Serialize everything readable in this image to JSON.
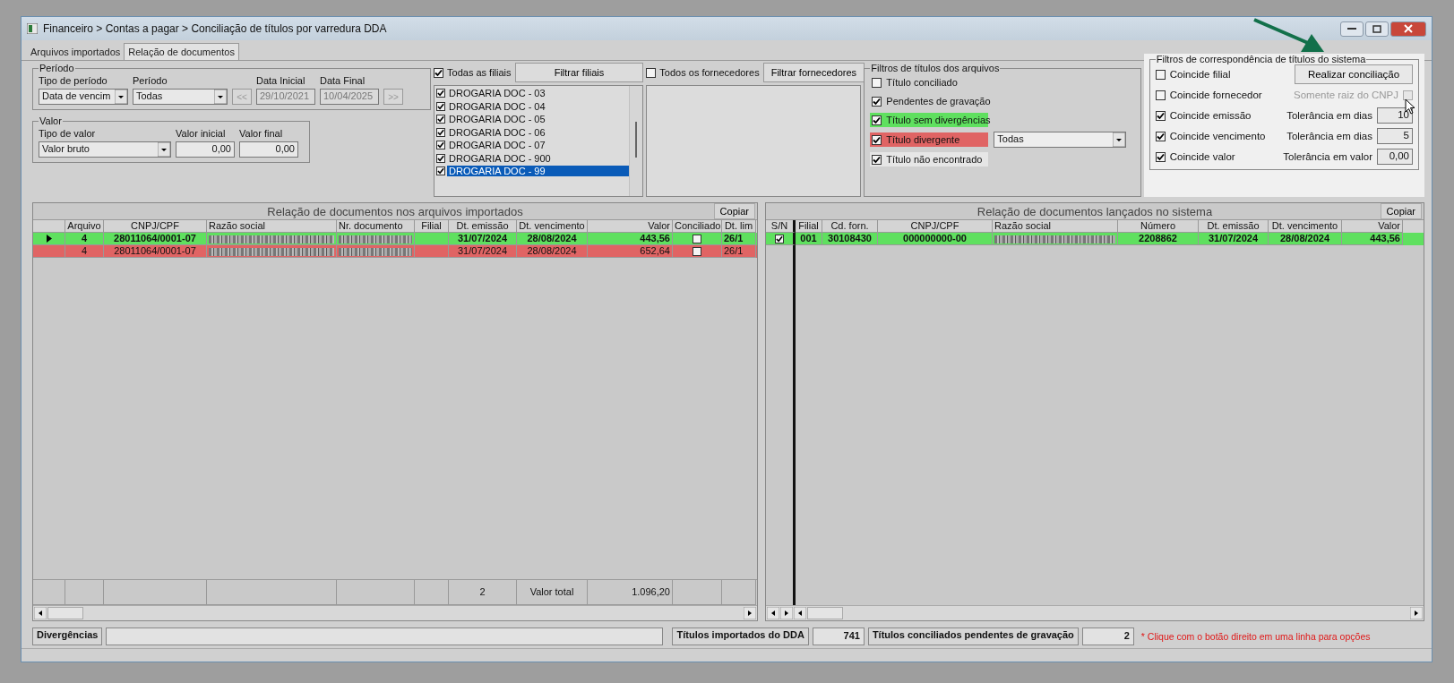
{
  "window": {
    "title": "Financeiro > Contas a pagar > Conciliação de títulos por varredura DDA"
  },
  "tabs": [
    {
      "label": "Arquivos importados",
      "selected": false
    },
    {
      "label": "Relação de documentos",
      "selected": true
    }
  ],
  "periodo": {
    "title": "Período",
    "tipo_label": "Tipo de período",
    "tipo_value": "Data de vencim",
    "periodo_label": "Período",
    "periodo_value": "Todas",
    "prev_button": "<<",
    "data_inicial_label": "Data Inicial",
    "data_inicial": "29/10/2021",
    "data_final_label": "Data Final",
    "data_final": "10/04/2025",
    "next_button": ">>"
  },
  "valor": {
    "title": "Valor",
    "tipo_label": "Tipo de valor",
    "tipo_value": "Valor bruto",
    "inicial_label": "Valor inicial",
    "inicial": "0,00",
    "final_label": "Valor final",
    "final": "0,00"
  },
  "filiais": {
    "all_label": "Todas as filiais",
    "all_checked": true,
    "button": "Filtrar filiais",
    "items": [
      {
        "label": "DROGARIA DOC - 03",
        "checked": true,
        "selected": false
      },
      {
        "label": "DROGARIA DOC - 04",
        "checked": true,
        "selected": false
      },
      {
        "label": "DROGARIA DOC - 05",
        "checked": true,
        "selected": false
      },
      {
        "label": "DROGARIA DOC - 06",
        "checked": true,
        "selected": false
      },
      {
        "label": "DROGARIA DOC - 07",
        "checked": true,
        "selected": false
      },
      {
        "label": "DROGARIA DOC - 900",
        "checked": true,
        "selected": false
      },
      {
        "label": "DROGARIA DOC - 99",
        "checked": true,
        "selected": true
      }
    ]
  },
  "fornecedores": {
    "all_label": "Todos os fornecedores",
    "all_checked": false,
    "button": "Filtrar fornecedores"
  },
  "filtros_arquivos": {
    "title": "Filtros de títulos dos arquivos",
    "items": [
      {
        "label": "Título conciliado",
        "checked": false
      },
      {
        "label": "Pendentes de gravação",
        "checked": true
      },
      {
        "label": "Título sem divergências",
        "checked": true,
        "color": "#5fe05f"
      },
      {
        "label": "Título divergente",
        "checked": true,
        "color": "#e06464",
        "dropdown": "Todas"
      },
      {
        "label": "Título não encontrado",
        "checked": true,
        "color": "#e6e6e6"
      }
    ]
  },
  "filtros_sistema": {
    "title": "Filtros de correspondência de títulos do sistema",
    "rows": [
      {
        "kind": "button",
        "label": "Coincide filial",
        "checked": false,
        "button": "Realizar conciliação"
      },
      {
        "kind": "option",
        "label": "Coincide fornecedor",
        "checked": false,
        "option_label": "Somente raiz do CNPJ",
        "option_checked": false,
        "option_disabled": true
      },
      {
        "kind": "tolerance",
        "label": "Coincide emissão",
        "checked": true,
        "tolerance_label": "Tolerância em dias",
        "tolerance": "10"
      },
      {
        "kind": "tolerance",
        "label": "Coincide vencimento",
        "checked": true,
        "tolerance_label": "Tolerância em dias",
        "tolerance": "5"
      },
      {
        "kind": "tolerance",
        "label": "Coincide valor",
        "checked": true,
        "tolerance_label": "Tolerância em valor",
        "tolerance": "0,00"
      }
    ]
  },
  "tables": {
    "left": {
      "title": "Relação de documentos nos arquivos importados",
      "copy_button": "Copiar",
      "columns": [
        {
          "label": "Arquivo",
          "kind": "center"
        },
        {
          "label": "CNPJ/CPF",
          "kind": "center"
        },
        {
          "label": "Razão social",
          "kind": "redacted"
        },
        {
          "label": "Nr. documento",
          "kind": "redacted"
        },
        {
          "label": "Filial",
          "kind": "center"
        },
        {
          "label": "Dt. emissão",
          "kind": "center"
        },
        {
          "label": "Dt. vencimento",
          "kind": "center"
        },
        {
          "label": "Valor",
          "kind": "right"
        },
        {
          "label": "Conciliado",
          "kind": "check"
        },
        {
          "label": "Dt. lim",
          "kind": "left"
        }
      ],
      "rows": [
        {
          "selected": true,
          "color": "#5fe05f",
          "cells": [
            "4",
            "28011064/0001-07",
            "",
            "",
            "",
            "31/07/2024",
            "28/08/2024",
            "443,56",
            false,
            "26/1"
          ]
        },
        {
          "selected": false,
          "color": "#e06464",
          "cells": [
            "4",
            "28011064/0001-07",
            "",
            "",
            "",
            "31/07/2024",
            "28/08/2024",
            "652,64",
            false,
            "26/1"
          ]
        }
      ],
      "footer": {
        "count": "2",
        "total_label": "Valor total",
        "total": "1.096,20"
      }
    },
    "right": {
      "title": "Relação de documentos lançados no sistema",
      "copy_button": "Copiar",
      "columns": [
        {
          "label": "S/N",
          "kind": "check"
        },
        {
          "label": "Filial",
          "kind": "center"
        },
        {
          "label": "Cd. forn.",
          "kind": "center"
        },
        {
          "label": "CNPJ/CPF",
          "kind": "center"
        },
        {
          "label": "Razão social",
          "kind": "redacted"
        },
        {
          "label": "Número",
          "kind": "center"
        },
        {
          "label": "Dt. emissão",
          "kind": "center"
        },
        {
          "label": "Dt. vencimento",
          "kind": "center"
        },
        {
          "label": "Valor",
          "kind": "right"
        }
      ],
      "rows": [
        {
          "color": "#5fe05f",
          "cells": [
            true,
            "001",
            "30108430",
            "000000000-00",
            "",
            "2208862",
            "31/07/2024",
            "28/08/2024",
            "443,56"
          ]
        }
      ]
    }
  },
  "bottom": {
    "divergencias_label": "Divergências",
    "importados_label": "Títulos importados do DDA",
    "importados": "741",
    "pendentes_label": "Títulos conciliados pendentes de gravação",
    "pendentes": "2",
    "hint": "* Clique com o botão direito em uma linha para opções"
  }
}
